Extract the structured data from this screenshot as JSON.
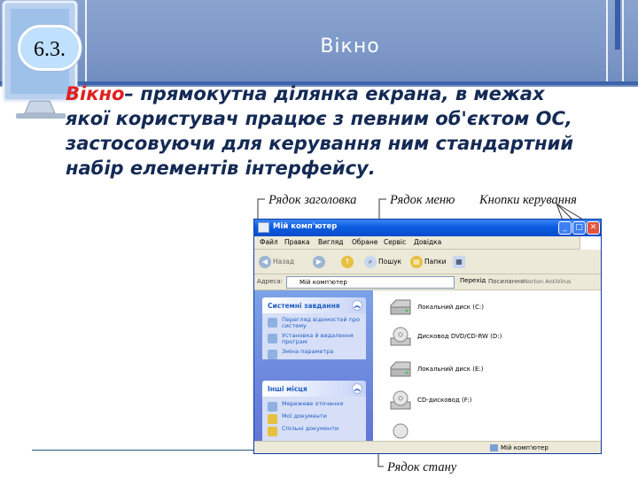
{
  "slide": {
    "number": "6.3.",
    "title": "Вікно",
    "definition": {
      "term": "Вікно",
      "line1_rest": "– прямокутна ділянка екрана, в межах",
      "line2": "якої користувач працює з певним об'єктом ОС,",
      "line3": "застосовуючи для керування ним стандартний",
      "line4": "набір елементів інтерфейсу."
    },
    "callouts": {
      "title_bar": "Рядок заголовка",
      "menu_bar": "Рядок меню",
      "control_buttons": "Кнопки керування",
      "status_bar": "Рядок стану"
    }
  },
  "window": {
    "title": "Мій комп'ютер",
    "menu": [
      "Файл",
      "Правка",
      "Вигляд",
      "Обране",
      "Сервіс",
      "Довідка"
    ],
    "toolbar": {
      "back": "Назад",
      "search": "Пошук",
      "folders": "Папки"
    },
    "address": {
      "label": "Адреса:",
      "value": "Мій комп'ютер",
      "go": "Перехід",
      "links": "Посилання",
      "norton": "Norton AntiVirus"
    },
    "panels": [
      {
        "title": "Системні завдання",
        "items": [
          "Перегляд відомостей про систему",
          "Установка й видалення програм",
          "Зміна параметра"
        ]
      },
      {
        "title": "Інші місця",
        "items": [
          "Мережеве оточення",
          "Мої документи",
          "Спільні документи"
        ]
      }
    ],
    "drives": [
      {
        "label": "Локальний диск (C:)"
      },
      {
        "label": "Дисковод DVD/CD-RW (D:)"
      },
      {
        "label": "Локальний диск (E:)"
      },
      {
        "label": "CD-дисковод (F:)"
      }
    ],
    "status": "Мій комп'ютер"
  },
  "colors": {
    "header": "#7e99c8",
    "definition_text": "#142a55",
    "term": "#e22020",
    "xp_titlebar": "#0b5cdf",
    "xp_sidebar": "#6375d6"
  }
}
